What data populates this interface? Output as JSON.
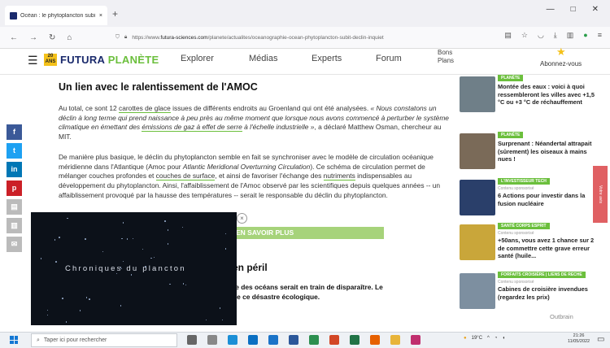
{
  "browser": {
    "tab_title": "Océan : le phytoplancton subi",
    "tab_close": "×",
    "new_tab": "+",
    "window_controls": [
      "—",
      "□",
      "✕"
    ],
    "url_prefix": "https://www.",
    "url_host": "futura-sciences.com",
    "url_path": "/planete/actualites/oceanographie-ocean-phytoplancton-subit-declin-inquiet"
  },
  "site": {
    "badge": "20 ANS",
    "logo_main": "FUTURA",
    "logo_accent": "PLANÈTE",
    "nav": [
      "Explorer",
      "Médias",
      "Experts",
      "Forum"
    ],
    "bons_plans": [
      "Bons",
      "Plans"
    ],
    "subscribe": "Abonnez-vous"
  },
  "article": {
    "heading": "Un lien avec le ralentissement de l'AMOC",
    "p1_a": "Au total, ce sont 12 ",
    "p1_link1": "carottes de glace",
    "p1_b": " issues de différents endroits au Groenland qui ont été analysées. ",
    "p1_quote_a": "« Nous constatons un déclin à long terme qui prend naissance à peu près au même moment que lorsque nous avons commencé à perturber le système climatique en émettant des ",
    "p1_link2": "émissions de gaz à effet de serre",
    "p1_quote_b": " à l'échelle industrielle »",
    "p1_c": ", a déclaré Matthew Osman, chercheur au MIT.",
    "p2_a": "De manière plus basique, le déclin du phytoplancton semble en fait se synchroniser avec le modèle de circulation océanique méridienne dans l'Atlantique (Amoc pour ",
    "p2_em": "Atlantic Meridional Overturning Circulation",
    "p2_b": "). Ce schéma de circulation permet de mélanger couches profondes et ",
    "p2_link1": "couches de surface",
    "p2_c": ", et ainsi de favoriser l'échange des ",
    "p2_link2": "nutriments",
    "p2_d": " indispensables au développement du phytoplancton. Ainsi, l'affaiblissement de l'Amoc observé par les scientifiques depuis quelques années -- un affaiblissement provoqué par la hausse des températures -- serait le responsable du déclin du phytoplancton.",
    "more_button": "EN SAVOIR PLUS",
    "heading2": "en péril",
    "p3_line1": "re des océans serait en train de disparaître. Le",
    "p3_line2": "de ce désastre écologique."
  },
  "video": {
    "title": "Chroniques du plancton",
    "close": "×"
  },
  "share_icons": [
    {
      "name": "facebook-icon",
      "glyph": "f",
      "color": "#3b5998"
    },
    {
      "name": "twitter-icon",
      "glyph": "t",
      "color": "#1da1f2"
    },
    {
      "name": "linkedin-icon",
      "glyph": "in",
      "color": "#0077b5"
    },
    {
      "name": "pinterest-icon",
      "glyph": "p",
      "color": "#cb2027"
    },
    {
      "name": "pdf-icon",
      "glyph": "▤",
      "color": "#bbbbbb"
    },
    {
      "name": "print-icon",
      "glyph": "▥",
      "color": "#bbbbbb"
    },
    {
      "name": "mail-icon",
      "glyph": "✉",
      "color": "#bbbbbb"
    }
  ],
  "sidebar": [
    {
      "tag": "PLANÈTE",
      "sponsored": "",
      "title": "Montée des eaux : voici à quoi ressembleront les villes avec +1,5 °C ou +3 °C de réchauffement",
      "img": "#6f7f88"
    },
    {
      "tag": "PLANÈTE",
      "sponsored": "",
      "title": "Surprenant : Néandertal attrapait (sûrement) les oiseaux à mains nues !",
      "img": "#7a6a58"
    },
    {
      "tag": "L'INVESTISSEUR TECH",
      "sponsored": "Contenu sponsorisé",
      "title": "6 Actions pour investir dans la fusion nucléaire",
      "img": "#2a3f6a"
    },
    {
      "tag": "SANTÉ CORPS ESPRIT",
      "sponsored": "Contenu sponsorisé",
      "title": "+50ans, vous avez 1 chance sur 2 de commettre cette grave erreur santé (huile...",
      "img": "#c9a63a"
    },
    {
      "tag": "FORFAITS CROISIÈRE | LIENS DE RECHE",
      "sponsored": "Contenu sponsorisé",
      "title": "Cabines de croisière invendues (regardez les prix)",
      "img": "#7d8fa0"
    }
  ],
  "outbrain": "Outbrain",
  "side_tab": "Votre avis",
  "taskbar": {
    "search_placeholder": "Taper ici pour rechercher",
    "temperature": "19°C",
    "time": "21:26",
    "date": "11/05/2022"
  },
  "colors": {
    "accent_green": "#6bbf3c",
    "brand_blue": "#1a2a6c",
    "badge_yellow": "#f4c11a"
  }
}
